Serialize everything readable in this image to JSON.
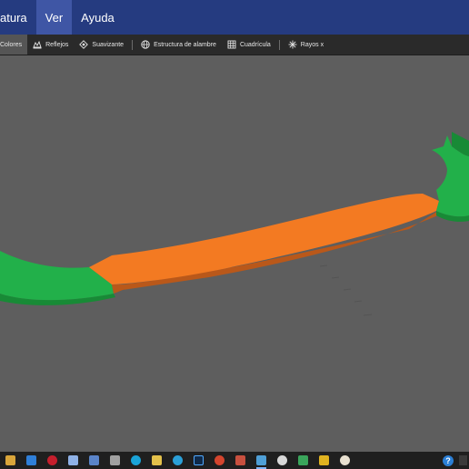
{
  "menu": {
    "items": [
      {
        "label": "atura"
      },
      {
        "label": "Ver"
      },
      {
        "label": "Ayuda"
      }
    ],
    "active_index": 1
  },
  "toolbar": {
    "colores": "Colores",
    "reflejos": "Reflejos",
    "suavizante": "Suavizante",
    "estructura": "Estructura de alambre",
    "cuadricula": "Cuadrícula",
    "rayos": "Rayos x"
  },
  "colors": {
    "menubar": "#253b80",
    "menu_active": "#3f56a5",
    "toolbar": "#2a2a2a",
    "viewport": "#5e5e5e",
    "model_orange": "#f37a22",
    "model_green": "#22b04a",
    "taskbar": "#1f1f1f"
  },
  "taskbar": {
    "help_label": "?",
    "apps": [
      "files",
      "mail",
      "opera",
      "notes",
      "docs",
      "calculator",
      "cura",
      "paint",
      "edge",
      "photoshop",
      "browser",
      "mosaic",
      "terminal",
      "3d-viewer",
      "app-15",
      "app-16",
      "app-17"
    ]
  }
}
